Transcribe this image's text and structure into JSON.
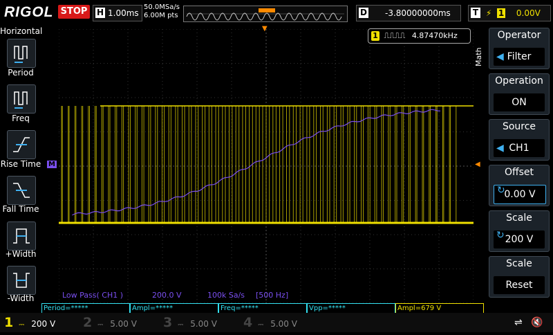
{
  "header": {
    "brand": "RIGOL",
    "run_state": "STOP",
    "timebase_key": "H",
    "timebase": "1.00ms",
    "sample_rate": "50.0MSa/s",
    "mem_depth": "6.00M pts",
    "delay_key": "D",
    "delay": "-3.80000000ms",
    "trigger_key": "T",
    "trigger_channel": "1",
    "trigger_level": "0.00V"
  },
  "horizontal_menu": {
    "title": "Horizontal",
    "items": [
      {
        "label": "Period"
      },
      {
        "label": "Freq"
      },
      {
        "label": "Rise Time"
      },
      {
        "label": "Fall Time"
      },
      {
        "label": "+Width"
      },
      {
        "label": "-Width"
      }
    ]
  },
  "right_menu": {
    "side_label": "Math",
    "items": [
      {
        "title": "Operator",
        "value": "Filter"
      },
      {
        "title": "Operation",
        "value": "ON"
      },
      {
        "title": "Source",
        "value": "CH1"
      },
      {
        "title": "Offset",
        "value": "0.00 V"
      },
      {
        "title": "Scale",
        "value": "200 V"
      },
      {
        "title": "Scale",
        "value": "Reset"
      }
    ]
  },
  "freq_counter": {
    "channel": "1",
    "value": "4.87470kHz"
  },
  "math_info": {
    "filter": "Low Pass( CH1 )",
    "scale": "200.0 V",
    "rate": "100k Sa/s",
    "cutoff": "[500 Hz]"
  },
  "measurements": [
    {
      "text": "Period=*****",
      "color": "#33e0f0"
    },
    {
      "text": "Ampl=*****",
      "color": "#33e0f0"
    },
    {
      "text": "Freq=*****",
      "color": "#33e0f0"
    },
    {
      "text": "Vpp=*****",
      "color": "#33e0f0"
    },
    {
      "text": "Ampl=679 V",
      "color": "#f0e000"
    }
  ],
  "channels": [
    {
      "num": "1",
      "scale": "200 V",
      "color": "#f0e000"
    },
    {
      "num": "2",
      "scale": "5.00 V",
      "color": "#33e0f0"
    },
    {
      "num": "3",
      "scale": "5.00 V",
      "color": "#e040d0"
    },
    {
      "num": "4",
      "scale": "5.00 V",
      "color": "#3f7cff"
    }
  ],
  "colors": {
    "ch1": "#f0e000",
    "math": "#7a4ff0",
    "trigger": "#ff8a00"
  }
}
